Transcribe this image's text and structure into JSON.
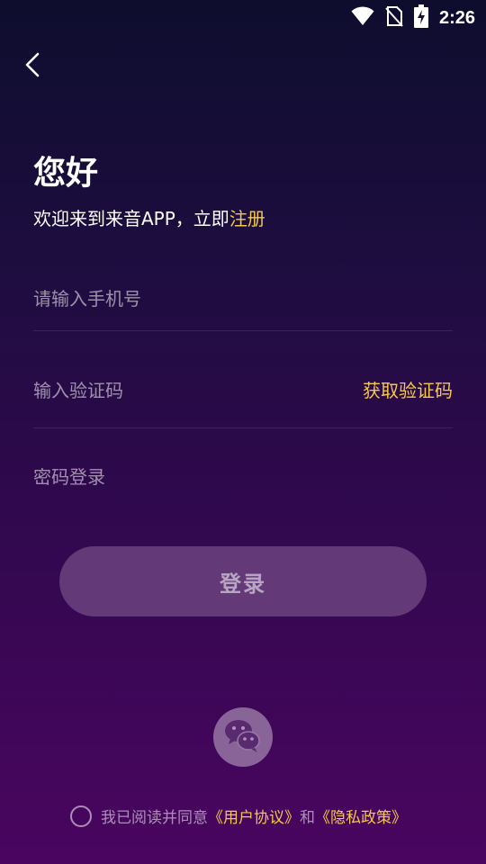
{
  "status_bar": {
    "time": "2:26",
    "icons": [
      "wifi-icon",
      "no-sim-icon",
      "battery-charging-icon"
    ]
  },
  "nav": {
    "back_icon": "chevron-left-icon"
  },
  "header": {
    "greeting": "您好",
    "subtitle_prefix": "欢迎来到来音APP，立即",
    "register_link": "注册"
  },
  "form": {
    "phone_placeholder": "请输入手机号",
    "code_placeholder": "输入验证码",
    "get_code_label": "获取验证码",
    "password_login_label": "密码登录",
    "login_button_label": "登录"
  },
  "social": {
    "wechat_icon": "wechat-icon"
  },
  "agreement": {
    "prefix": "我已阅读并同意",
    "user_agreement": "《用户协议》",
    "connector": "和",
    "privacy_policy": "《隐私政策》",
    "checked": false
  },
  "colors": {
    "accent": "#f5c84c",
    "login_button_bg": "#633977",
    "background_top": "#0e0d2e",
    "background_bottom": "#4a0560"
  }
}
